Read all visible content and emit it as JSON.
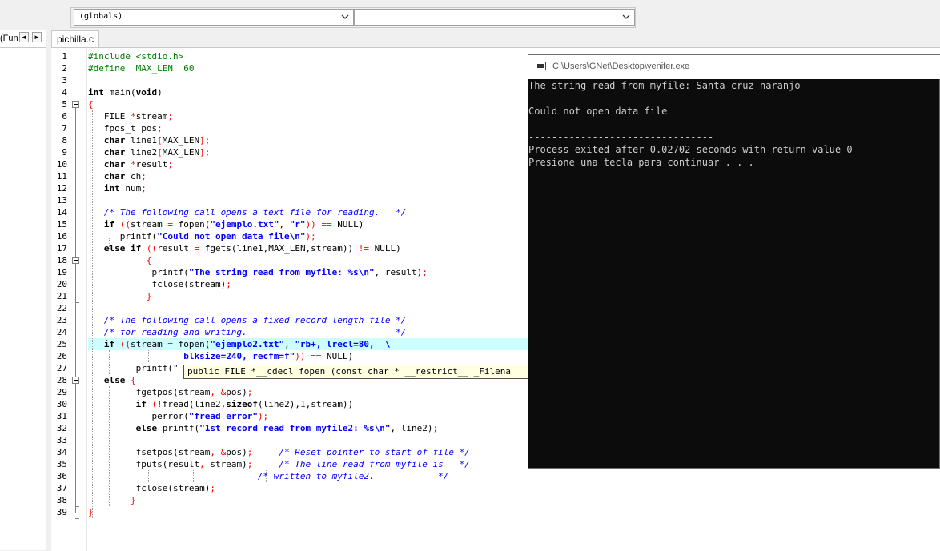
{
  "toolbar": {
    "scope_combo": "(globals)",
    "member_combo": ""
  },
  "left_panel": {
    "tab_label": "(Fun",
    "nav_prev": "◄",
    "nav_next": "►"
  },
  "editor": {
    "file_tab": "pichilla.c",
    "line_numbers": [
      "1",
      "2",
      "3",
      "4",
      "5",
      "6",
      "7",
      "8",
      "9",
      "10",
      "11",
      "12",
      "13",
      "14",
      "15",
      "16",
      "17",
      "18",
      "19",
      "20",
      "21",
      "22",
      "23",
      "24",
      "25",
      "26",
      "27",
      "28",
      "29",
      "30",
      "31",
      "32",
      "33",
      "34",
      "35",
      "36",
      "37",
      "38",
      "39"
    ],
    "highlighted_line": 25,
    "tooltip": "public FILE *__cdecl fopen (const char * __restrict__ _Filena"
  },
  "code": {
    "l1": "#include <stdio.h>",
    "l2": "#define  MAX_LEN  60",
    "l4a": "int",
    "l4b": " main(",
    "l4c": "void",
    "l4d": ")",
    "l5": "{",
    "l6a": "   FILE ",
    "l6b": "*",
    "l6c": "stream",
    "l6d": ";",
    "l7a": "   fpos_t pos",
    "l7b": ";",
    "l8a": "   ",
    "l8b": "char",
    "l8c": " line1",
    "l8d": "[",
    "l8e": "MAX_LEN",
    "l8f": "];",
    "l9a": "   ",
    "l9b": "char",
    "l9c": " line2",
    "l9d": "[",
    "l9e": "MAX_LEN",
    "l9f": "];",
    "l10a": "   ",
    "l10b": "char",
    "l10c": " ",
    "l10d": "*",
    "l10e": "result",
    "l10f": ";",
    "l11a": "   ",
    "l11b": "char",
    "l11c": " ch",
    "l11d": ";",
    "l12a": "   ",
    "l12b": "int",
    "l12c": " num",
    "l12d": ";",
    "l14": "   /* The following call opens a text file for reading.   */",
    "l15a": "   ",
    "l15b": "if",
    "l15c": " ((",
    "l15d": "stream ",
    "l15e": "=",
    "l15f": " fopen(",
    "l15g": "\"ejemplo.txt\"",
    "l15h": ", ",
    "l15i": "\"r\"",
    "l15j": ")) ",
    "l15k": "==",
    "l15l": " NULL)",
    "l16a": "      printf(",
    "l16b": "\"Could not open data file\\n\"",
    "l16c": ");",
    "l17a": "   ",
    "l17b": "else",
    "l17c": " ",
    "l17d": "if",
    "l17e": " ((",
    "l17f": "result ",
    "l17g": "=",
    "l17h": " fgets(line1,MAX_LEN,stream)) ",
    "l17i": "!=",
    "l17j": " NULL)",
    "l18": "           {",
    "l19a": "            printf(",
    "l19b": "\"The string read from myfile: %s\\n\"",
    "l19c": ", result)",
    "l19d": ";",
    "l20a": "            fclose(stream)",
    "l20b": ";",
    "l21": "           }",
    "l23": "   /* The following call opens a fixed record length file */",
    "l24": "   /* for reading and writing.                            */",
    "l25a": "   ",
    "l25b": "if",
    "l25c": " ((",
    "l25d": "stream ",
    "l25e": "=",
    "l25f": " fopen(",
    "l25g": "\"ejemplo2.txt\"",
    "l25h": ", ",
    "l25i": "\"rb+, lrecl=80,  \\",
    "l26a": "                  ",
    "l26b": "blksize=240, recfm=f\"",
    "l26c": ")) ",
    "l26d": "==",
    "l26e": " NULL)",
    "l27a": "         printf(\"",
    "l28a": "   ",
    "l28b": "else",
    "l28c": " ",
    "l28d": "{",
    "l29a": "         fgetpos(stream",
    "l29b": ", &",
    "l29c": "pos)",
    "l29d": ";",
    "l30a": "         ",
    "l30b": "if",
    "l30c": " (",
    "l30d": "!",
    "l30e": "fread(line2,",
    "l30f": "sizeof",
    "l30g": "(line2),",
    "l30h": "1",
    "l30i": ",stream))",
    "l31a": "            perror(",
    "l31b": "\"fread error\"",
    "l31c": ");",
    "l32a": "         ",
    "l32b": "else",
    "l32c": " printf(",
    "l32d": "\"1st record read from myfile2: %s\\n\"",
    "l32e": ", line2)",
    "l32f": ";",
    "l34a": "         fsetpos(stream",
    "l34b": ", &",
    "l34c": "pos)",
    "l34d": ";",
    "l34e": "     /* Reset pointer to start of file */",
    "l35a": "         fputs(result",
    "l35b": ",",
    "l35c": " stream)",
    "l35d": ";",
    "l35e": "     /* The line read from myfile is   */",
    "l36": "                                /* written to myfile2.            */",
    "l37a": "         fclose(stream)",
    "l37b": ";",
    "l38": "        }",
    "l39": "}"
  },
  "console": {
    "title": "C:\\Users\\GNet\\Desktop\\yenifer.exe",
    "lines": [
      "The string read from myfile: Santa cruz naranjo",
      "",
      "Could not open data file",
      "",
      "--------------------------------",
      "Process exited after 0.02702 seconds with return value 0",
      "Presione una tecla para continuar . . ."
    ]
  },
  "colors": {
    "keyword": "#000000",
    "preprocessor": "#008000",
    "comment": "#0000ff",
    "string": "#0000ff",
    "symbol": "#ff0000",
    "number": "#800080",
    "current_line": "#ccffff",
    "console_bg": "#0c0c0c",
    "console_text": "#cccccc"
  }
}
